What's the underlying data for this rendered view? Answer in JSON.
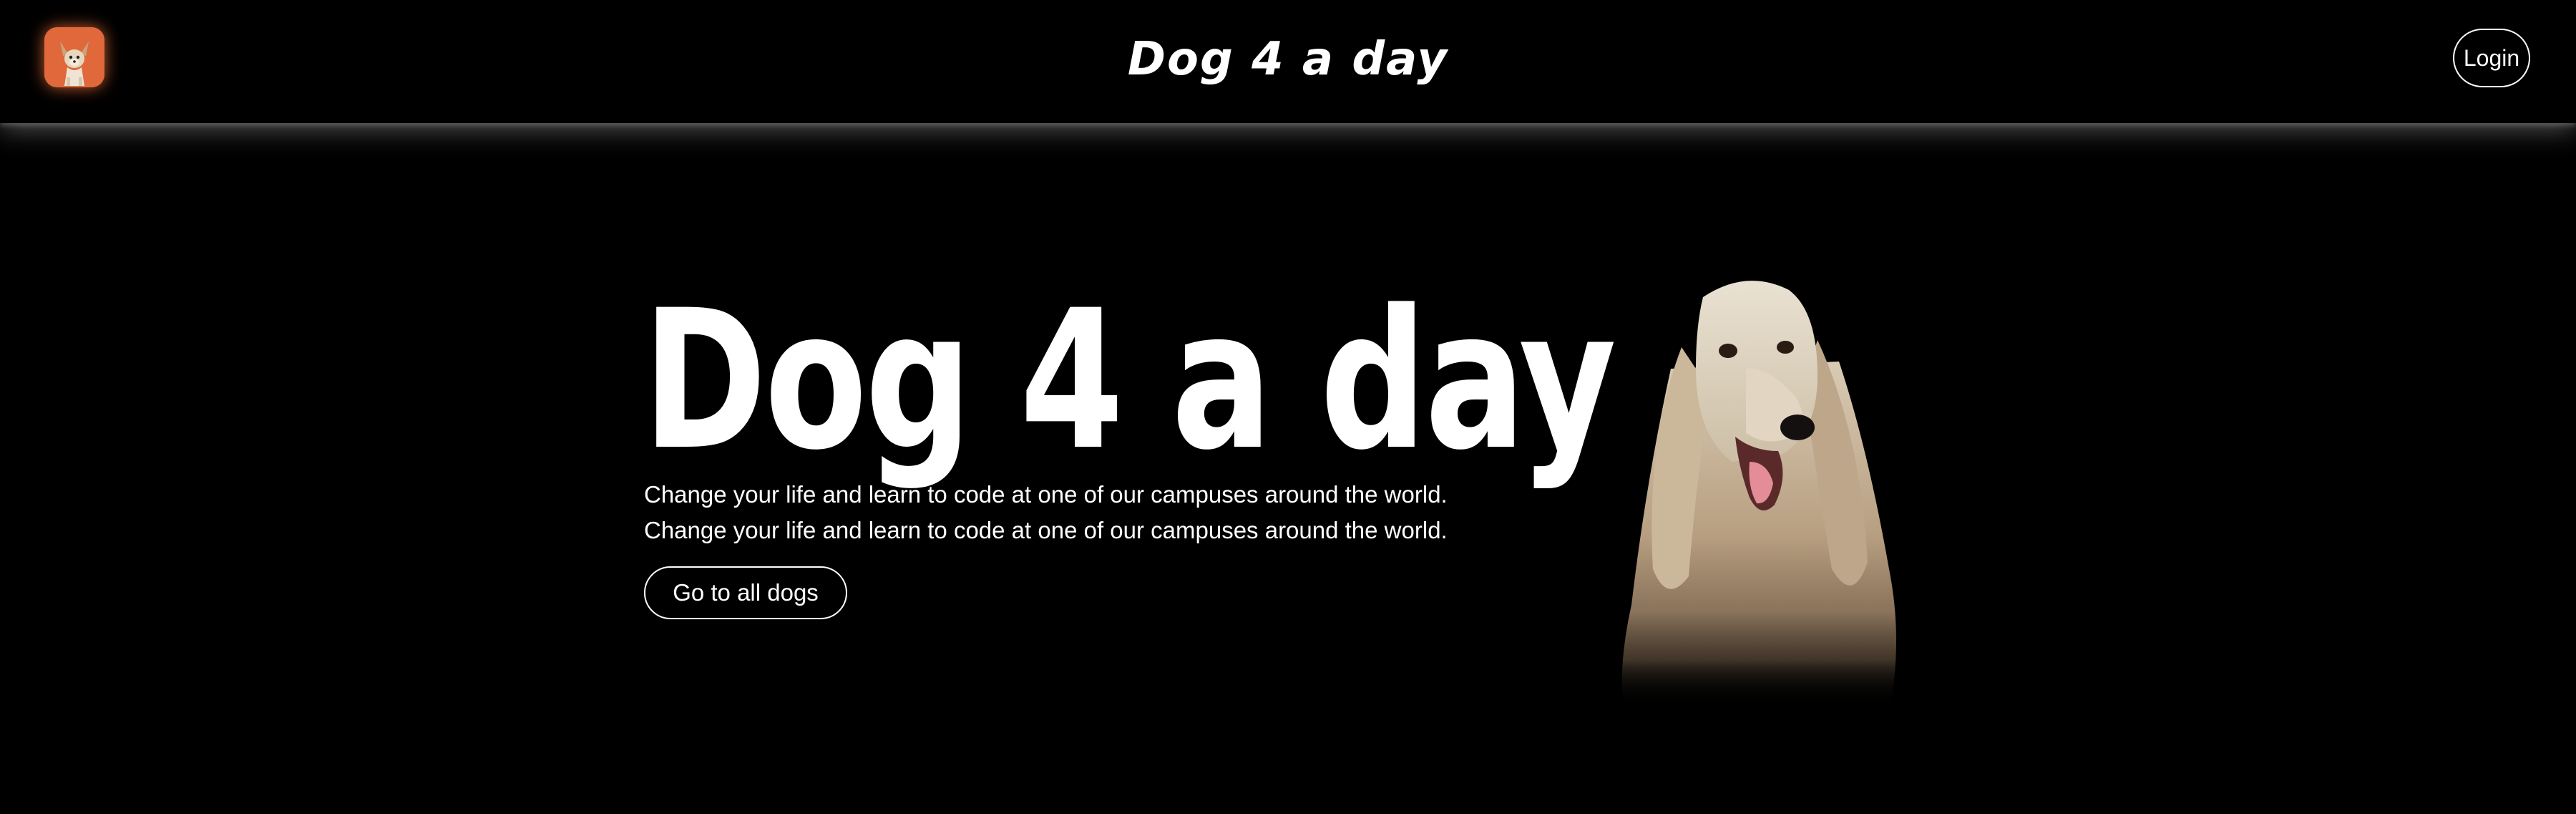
{
  "header": {
    "brand": "Dog 4 a day",
    "login_label": "Login"
  },
  "hero": {
    "title": "Dog 4 a day",
    "description": "Change your life and learn to code at one of our campuses around the world. Change your life and learn to code at one of our campuses around the world.",
    "cta_label": "Go to all dogs"
  },
  "icons": {
    "logo": "chihuahua-avatar-icon",
    "brand_paw": "paw-icon",
    "hero_image": "afghan-hound-photo"
  },
  "colors": {
    "background": "#000000",
    "text": "#ffffff",
    "logo_accent": "#e0683a"
  }
}
